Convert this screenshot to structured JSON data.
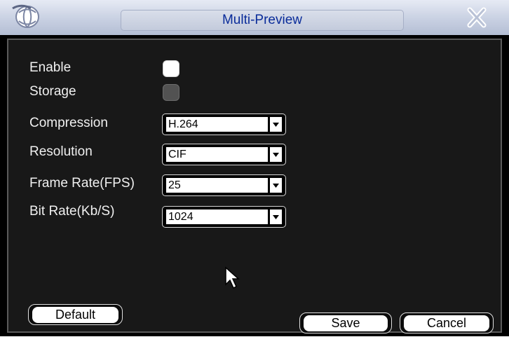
{
  "window": {
    "title": "Multi-Preview"
  },
  "form": {
    "enable": {
      "label": "Enable",
      "checked": true
    },
    "storage": {
      "label": "Storage",
      "checked": false
    },
    "compression": {
      "label": "Compression",
      "value": "H.264"
    },
    "resolution": {
      "label": "Resolution",
      "value": "CIF"
    },
    "frame_rate": {
      "label": "Frame Rate(FPS)",
      "value": "25"
    },
    "bit_rate": {
      "label": "Bit Rate(Kb/S)",
      "value": "1024"
    }
  },
  "buttons": {
    "default": "Default",
    "save": "Save",
    "cancel": "Cancel"
  },
  "colors": {
    "title_text": "#0a2c9a",
    "panel_bg": "#181818",
    "label_text": "#f0f0f0"
  }
}
